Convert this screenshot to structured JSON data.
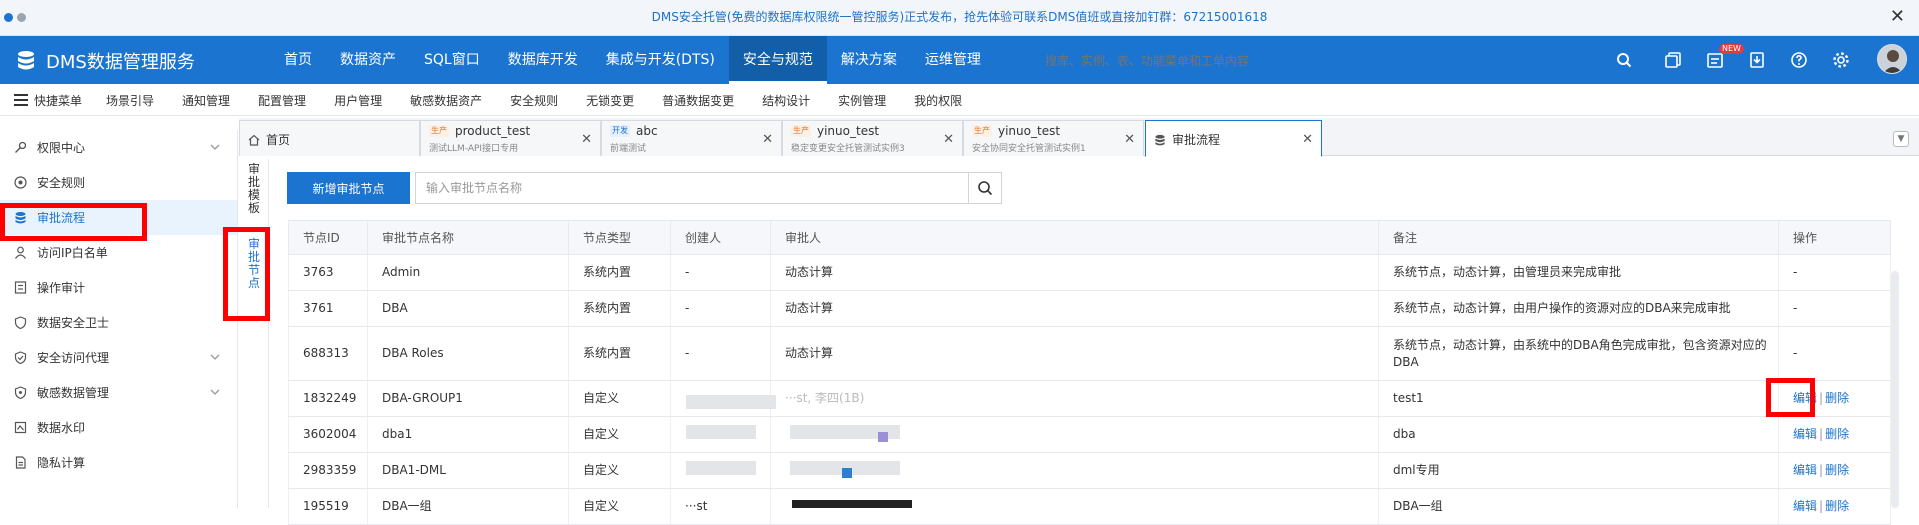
{
  "notice": {
    "text": "DMS安全托管(免费的数据库权限统一管控服务)正式发布，抢先体验可联系DMS值班或直接加钉群：67215001618",
    "close": "✕"
  },
  "brand": {
    "title": "DMS数据管理服务"
  },
  "topnav": {
    "items": [
      "首页",
      "数据资产",
      "SQL窗口",
      "数据库开发",
      "集成与开发(DTS)",
      "安全与规范",
      "解决方案",
      "运维管理"
    ],
    "search_placeholder": "搜库、实例、表、功能菜单和工单内容",
    "badge": "NEW"
  },
  "subnav": {
    "quick_menu": "快捷菜单",
    "items": [
      "场景引导",
      "通知管理",
      "配置管理",
      "用户管理",
      "敏感数据资产",
      "安全规则",
      "无锁变更",
      "普通数据变更",
      "结构设计",
      "实例管理",
      "我的权限"
    ]
  },
  "sidebar": {
    "items": [
      "权限中心",
      "安全规则",
      "审批流程",
      "访问IP白名单",
      "操作审计",
      "数据安全卫士",
      "安全访问代理",
      "敏感数据管理",
      "数据水印",
      "隐私计算"
    ]
  },
  "tabs": [
    {
      "title": "首页"
    },
    {
      "env": "生产",
      "title": "product_test",
      "sub": "测试LLM-API接口专用"
    },
    {
      "env": "开发",
      "title": "abc",
      "sub": "前端测试"
    },
    {
      "env": "生产",
      "title": "yinuo_test",
      "sub": "稳定变更安全托管测试实例3"
    },
    {
      "env": "生产",
      "title": "yinuo_test",
      "sub": "安全协同安全托管测试实例1"
    },
    {
      "title": "审批流程"
    }
  ],
  "vtabs": {
    "template": "审批模板",
    "node": "审批节点"
  },
  "toolbar": {
    "add_button": "新增审批节点",
    "search_placeholder": "输入审批节点名称"
  },
  "table": {
    "headers": [
      "节点ID",
      "审批节点名称",
      "节点类型",
      "创建人",
      "审批人",
      "备注",
      "操作"
    ],
    "rows": [
      {
        "id": "3763",
        "name": "Admin",
        "type": "系统内置",
        "creator": "-",
        "approver": "动态计算",
        "remark": "系统节点，动态计算，由管理员来完成审批",
        "ops": "-"
      },
      {
        "id": "3761",
        "name": "DBA",
        "type": "系统内置",
        "creator": "-",
        "approver": "动态计算",
        "remark": "系统节点，动态计算，由用户操作的资源对应的DBA来完成审批",
        "ops": "-"
      },
      {
        "id": "688313",
        "name": "DBA Roles",
        "type": "系统内置",
        "creator": "-",
        "approver": "动态计算",
        "remark": "系统节点，动态计算，由系统中的DBA角色完成审批，包含资源对应的DBA",
        "ops": "-"
      },
      {
        "id": "1832249",
        "name": "DBA-GROUP1",
        "type": "自定义",
        "creator": "",
        "approver": "···st, 李四(1B)",
        "remark": "test1",
        "edit": "编辑",
        "del": "删除"
      },
      {
        "id": "3602004",
        "name": "dba1",
        "type": "自定义",
        "creator": "",
        "approver": "",
        "remark": "dba",
        "edit": "编辑",
        "del": "删除"
      },
      {
        "id": "2983359",
        "name": "DBA1-DML",
        "type": "自定义",
        "creator": "",
        "approver": "",
        "remark": "dml专用",
        "edit": "编辑",
        "del": "删除"
      },
      {
        "id": "195519",
        "name": "DBA一组",
        "type": "自定义",
        "creator": "···st",
        "approver": "",
        "remark": "DBA一组",
        "edit": "编辑",
        "del": "删除"
      }
    ]
  },
  "colors": {
    "brand": "#1b74cf",
    "highlight": "#ff0000"
  }
}
